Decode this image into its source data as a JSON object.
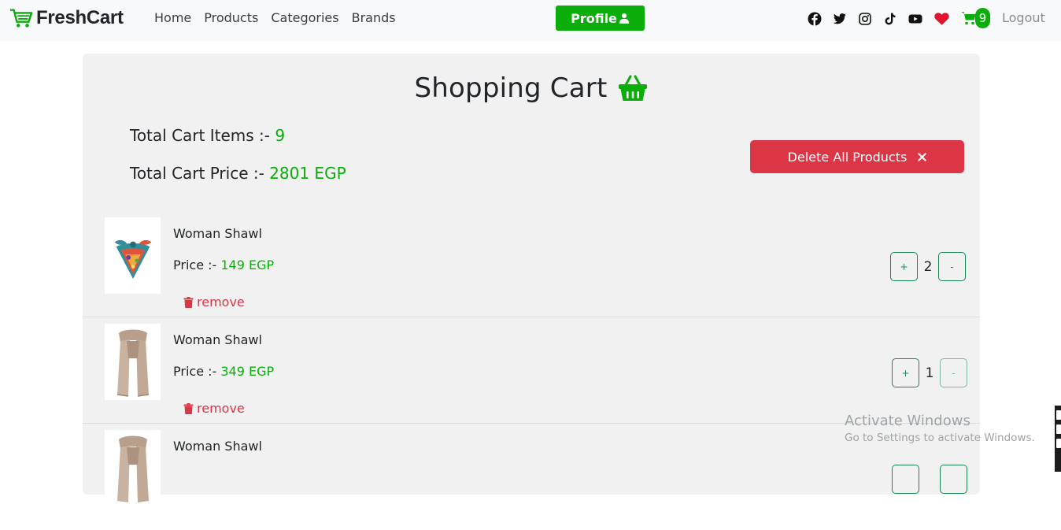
{
  "navbar": {
    "brand": "FreshCart",
    "links": [
      "Home",
      "Products",
      "Categories",
      "Brands"
    ],
    "profile_label": "Profile",
    "cart_count": "9",
    "logout_label": "Logout",
    "social_icons": [
      "facebook-icon",
      "twitter-icon",
      "instagram-icon",
      "tiktok-icon",
      "youtube-icon",
      "heart-icon"
    ]
  },
  "cart": {
    "title": "Shopping Cart",
    "total_items_label": "Total Cart Items :-",
    "total_items_value": "9",
    "total_price_label": "Total Cart Price :-",
    "total_price_value": "2801 EGP",
    "delete_all_label": "Delete All Products",
    "price_prefix": "Price :-",
    "remove_label": "remove",
    "items": [
      {
        "name": "Woman Shawl",
        "price": "149 EGP",
        "qty": "2",
        "image": "colorful-scarf"
      },
      {
        "name": "Woman Shawl",
        "price": "349 EGP",
        "qty": "1",
        "image": "beige-scarf"
      },
      {
        "name": "Woman Shawl",
        "price": "",
        "qty": "",
        "image": "beige-scarf"
      }
    ]
  },
  "watermark": {
    "title": "Activate Windows",
    "subtitle": "Go to Settings to activate Windows."
  },
  "colors": {
    "accent": "#0aad0a",
    "danger": "#dc3545",
    "panel": "#f0f1f0"
  }
}
